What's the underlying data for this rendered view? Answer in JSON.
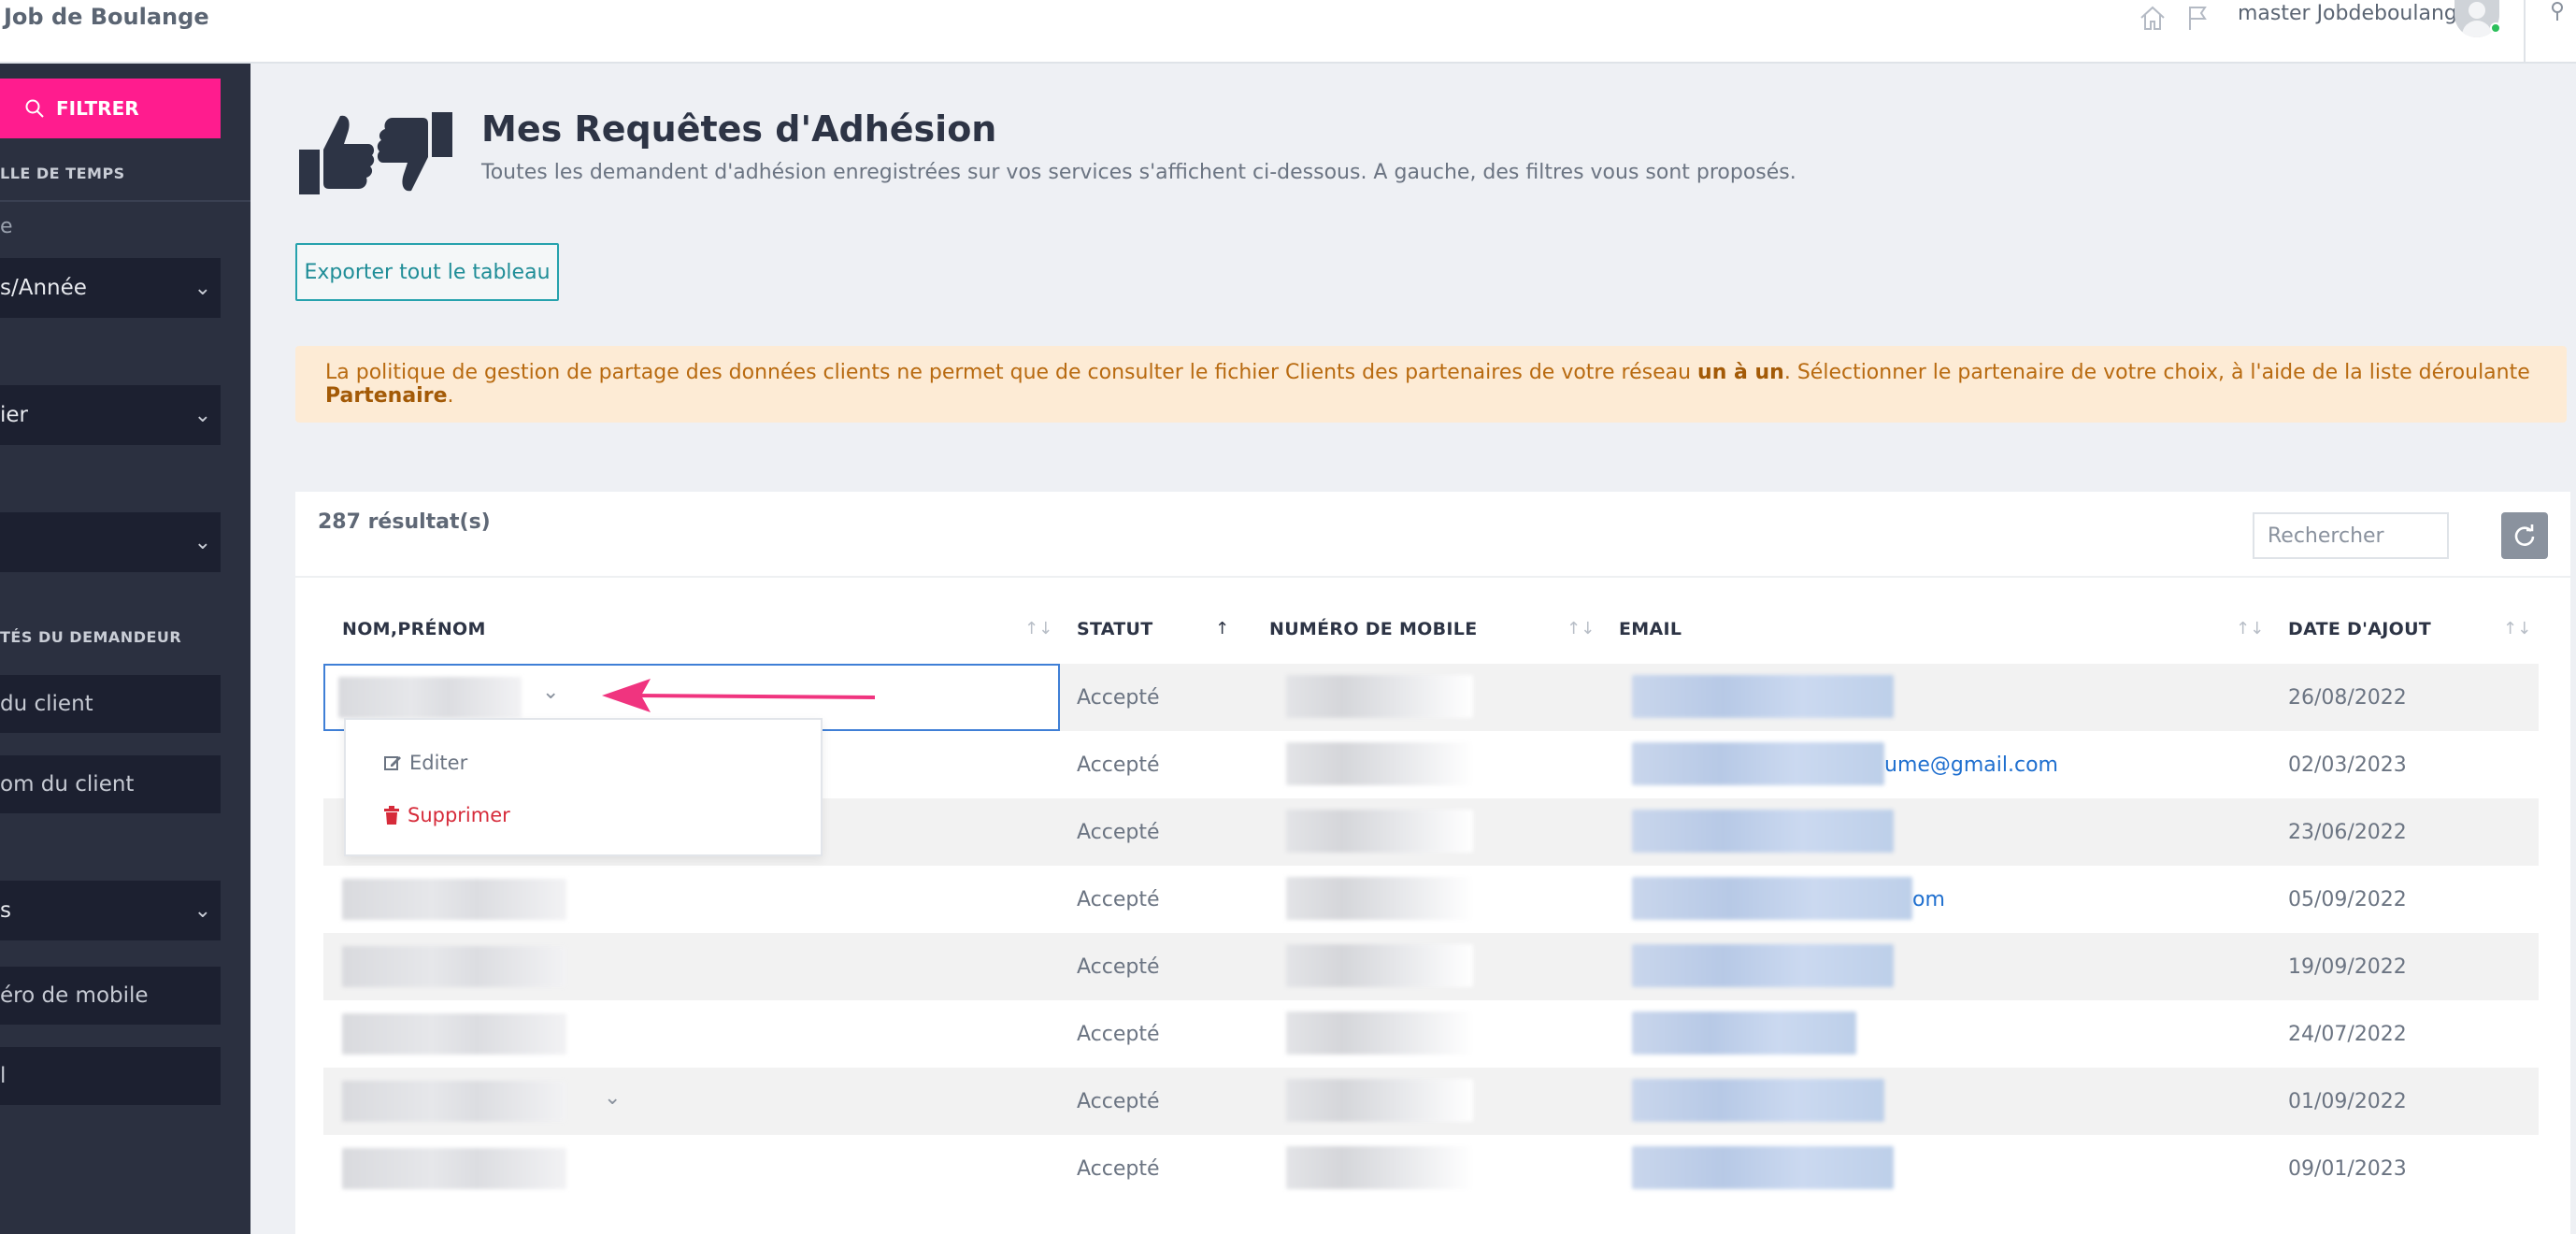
{
  "app": {
    "brand": "Job de Boulange"
  },
  "topbar": {
    "user_name": "master Jobdeboulange"
  },
  "sidebar": {
    "filter_label": "FILTRER",
    "section_time": "LLE DE TEMPS",
    "time_sub": "e",
    "period_select": "s/Année",
    "select_2": "ier",
    "select_3": "",
    "section_requester": "TÉS DU DEMANDEUR",
    "client_input": " du client",
    "client_name_input": "om du client",
    "select_4": "s",
    "mobile_input": "éro de mobile",
    "email_input": "l"
  },
  "header": {
    "title": "Mes Requêtes d'Adhésion",
    "subtitle": "Toutes les demandent d'adhésion enregistrées sur vos services s'affichent ci-dessous. A gauche, des filtres vous sont proposés.",
    "export_button": "Exporter tout le tableau"
  },
  "alert": {
    "text_1": "La politique de gestion de partage des données clients ne permet que de consulter le fichier Clients des partenaires de votre réseau ",
    "bold_1": "un à un",
    "text_2": ". Sélectionner le partenaire de votre choix, à l'aide de la liste déroulante ",
    "bold_2": "Partenaire",
    "text_3": "."
  },
  "table": {
    "results_count": "287 résultat(s)",
    "search_placeholder": "Rechercher",
    "columns": {
      "name": "NOM,PRÉNOM",
      "status": "STATUT",
      "mobile": "NUMÉRO DE MOBILE",
      "email": "EMAIL",
      "date": "DATE D'AJOUT"
    },
    "rows": [
      {
        "status": "Accepté",
        "email_tail": "",
        "date": "26/08/2022"
      },
      {
        "status": "Accepté",
        "email_tail": "ume@gmail.com",
        "date": "02/03/2023"
      },
      {
        "status": "Accepté",
        "email_tail": "",
        "date": "23/06/2022"
      },
      {
        "status": "Accepté",
        "email_tail": "om",
        "date": "05/09/2022"
      },
      {
        "status": "Accepté",
        "email_tail": "",
        "date": "19/09/2022"
      },
      {
        "status": "Accepté",
        "email_tail": "",
        "date": "24/07/2022"
      },
      {
        "status": "Accepté",
        "email_tail": "",
        "date": "01/09/2022"
      },
      {
        "status": "Accepté",
        "email_tail": "",
        "date": "09/01/2023"
      }
    ]
  },
  "dropdown": {
    "edit_label": "Editer",
    "delete_label": "Supprimer"
  },
  "colors": {
    "accent": "#ff1c8e",
    "sidebar": "#2b3040",
    "export": "#26a2ad",
    "alert_bg": "#fdebd5",
    "delete": "#d62b3a",
    "link": "#1f6fcf"
  }
}
